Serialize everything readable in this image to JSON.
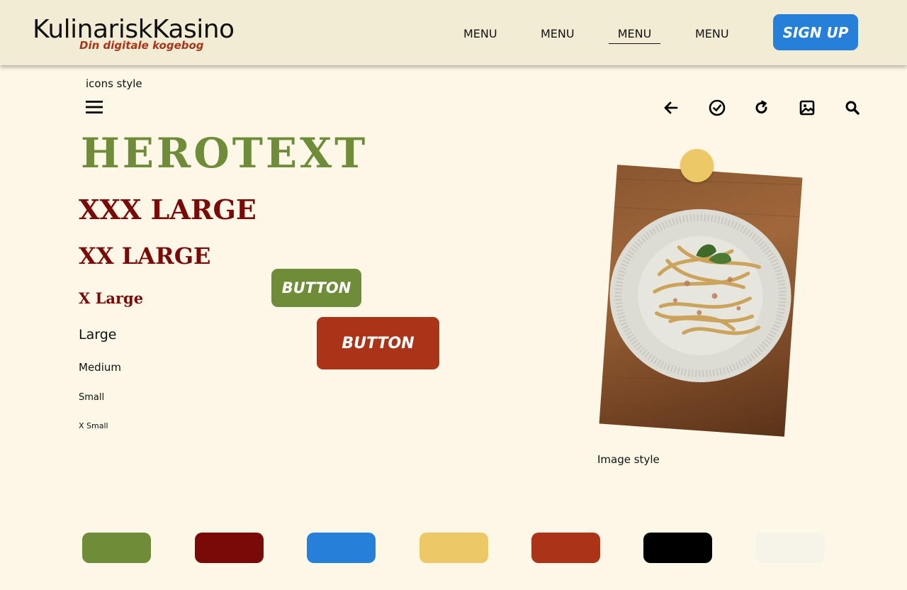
{
  "header": {
    "brand_title": "KulinariskKasino",
    "brand_tagline": "Din digitale kogebog",
    "nav": [
      "MENU",
      "MENU",
      "MENU",
      "MENU"
    ],
    "active_nav_index": 2,
    "signup_label": "SIGN UP"
  },
  "icons_section": {
    "label": "icons style",
    "icons": [
      "hamburger-menu-icon",
      "arrow-left-icon",
      "check-circle-icon",
      "refresh-icon",
      "image-icon",
      "search-icon"
    ]
  },
  "typography": {
    "hero": "HEROTEXT",
    "xxx_large": "XXX LARGE",
    "xx_large": "XX LARGE",
    "x_large": "X Large",
    "large": "Large",
    "medium": "Medium",
    "small": "Small",
    "x_small": "X Small"
  },
  "buttons": {
    "primary_label": "BUTTON",
    "secondary_label": "BUTTON"
  },
  "image_section": {
    "label": "Image style"
  },
  "palette": {
    "swatches": [
      "#6f8d38",
      "#7a0a08",
      "#2680d9",
      "#ecc966",
      "#ab3418",
      "#000000",
      "#f6f3e8"
    ]
  }
}
